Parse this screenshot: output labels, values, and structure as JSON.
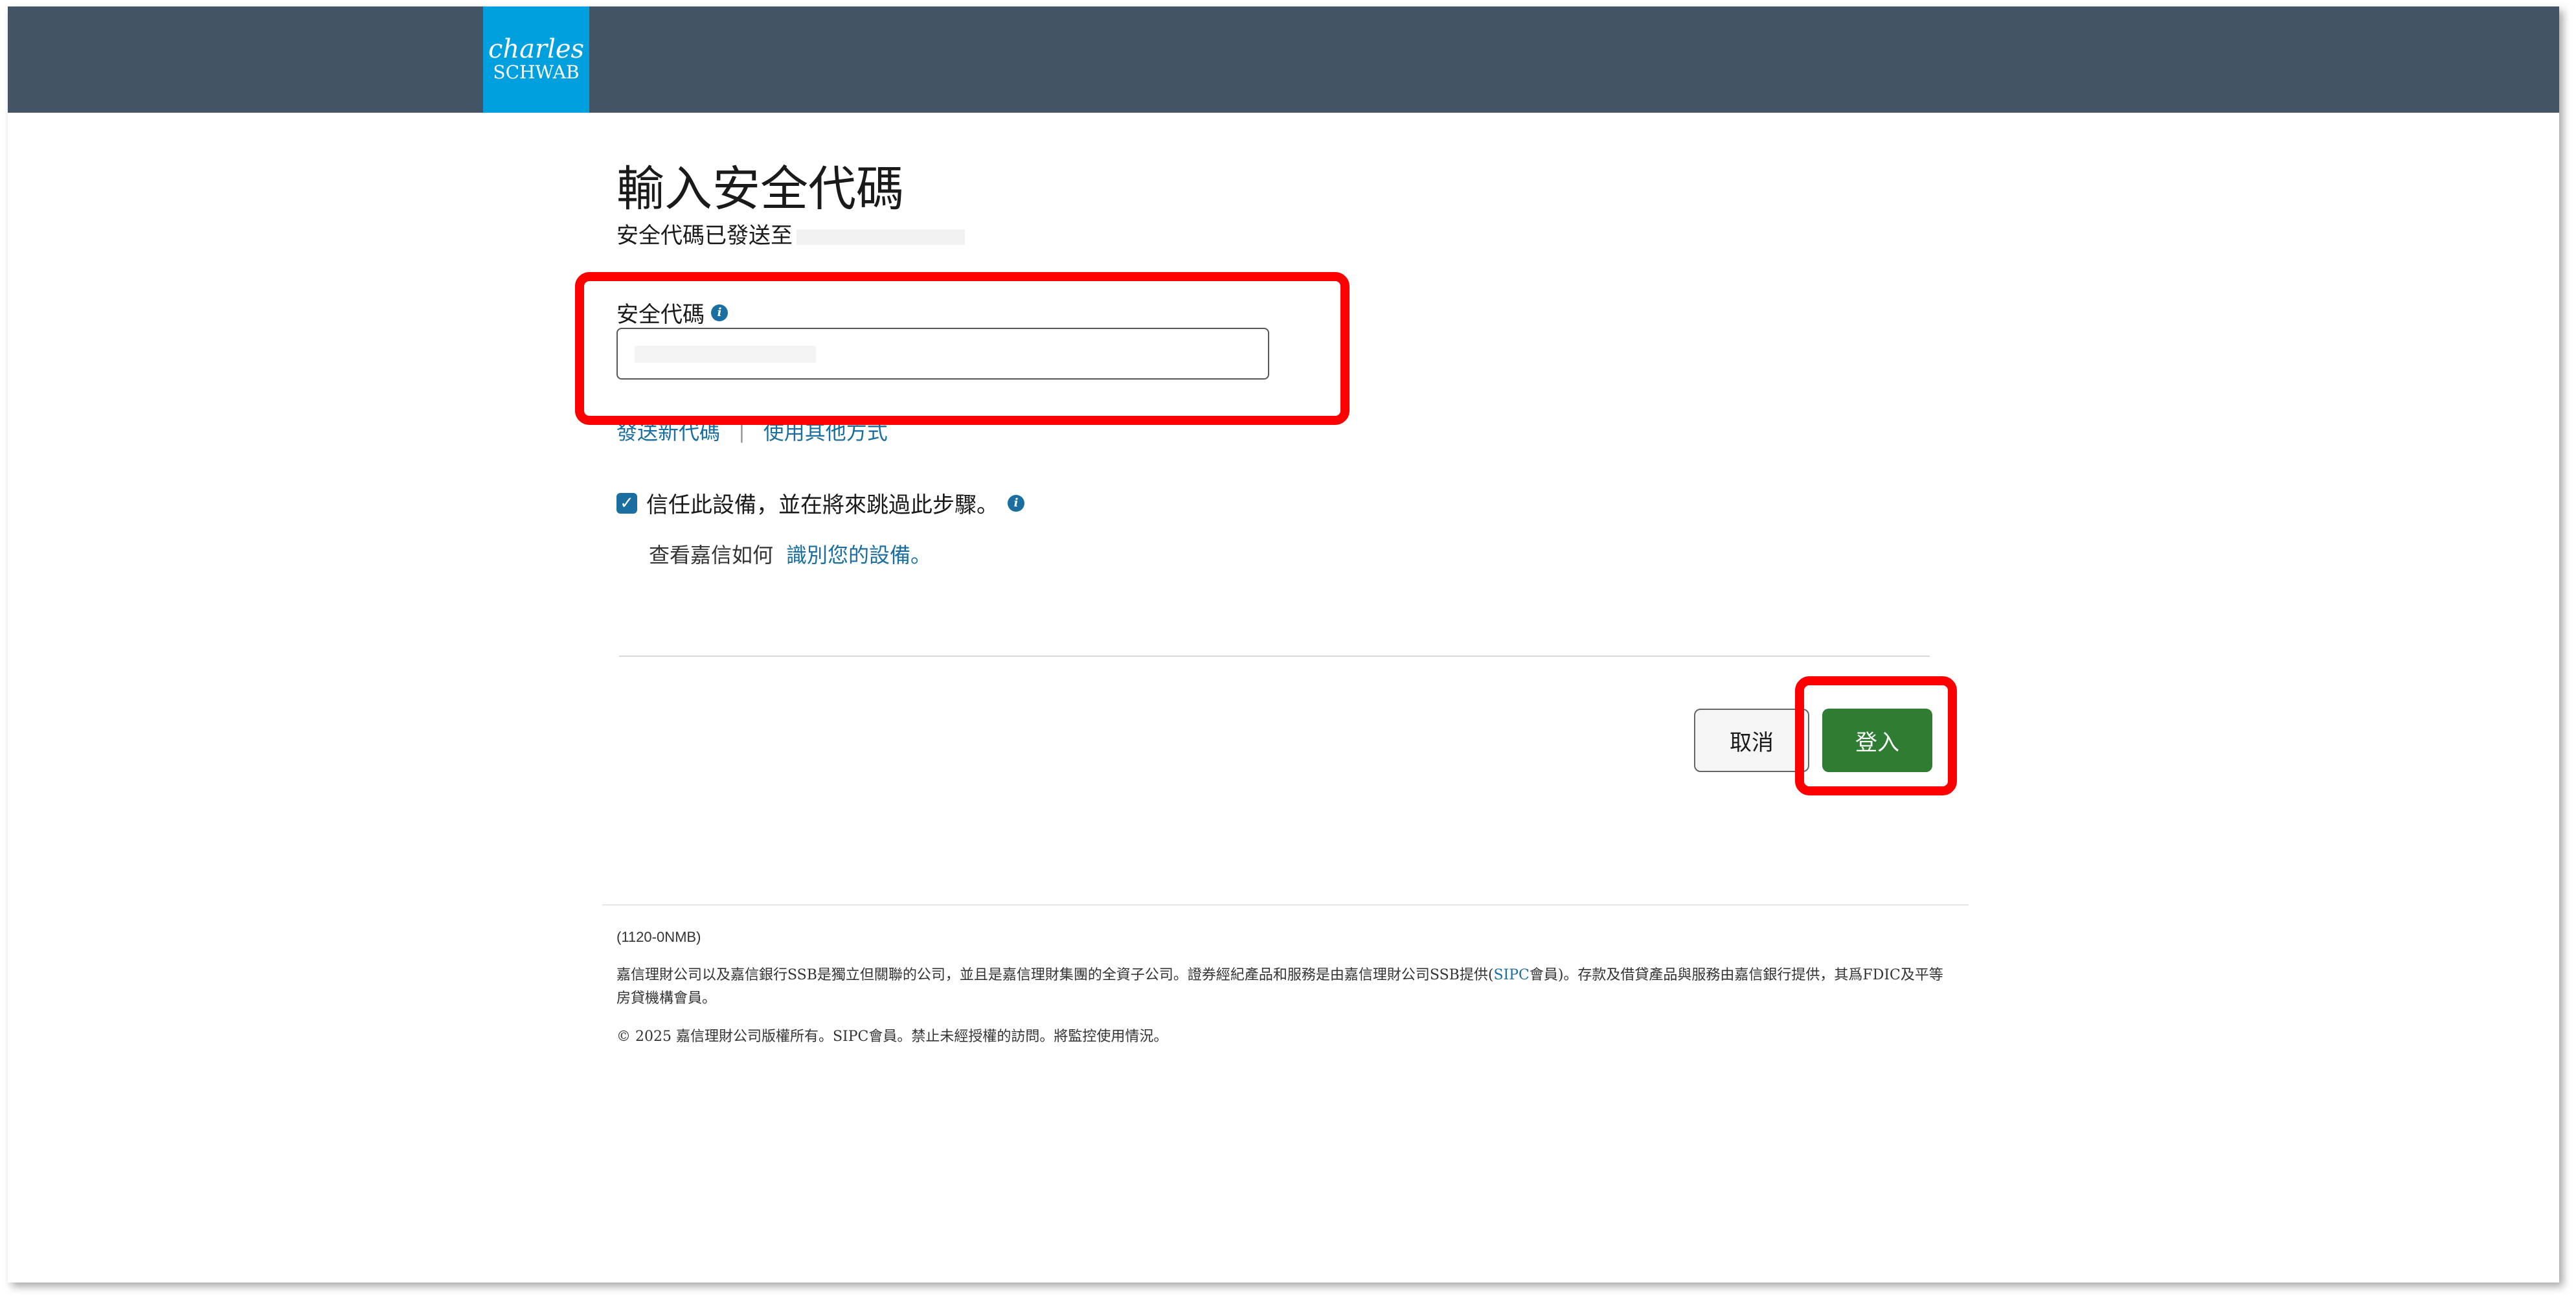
{
  "header": {
    "logo_line1": "charles",
    "logo_line2": "SCHWAB",
    "colors": {
      "bar": "#435564",
      "logo": "#00a0df"
    }
  },
  "page": {
    "title": "輸入安全代碼",
    "subtitle": "安全代碼已發送至"
  },
  "form": {
    "code_label": "安全代碼",
    "info_icon": "info-icon",
    "code_value": "",
    "link_resend": "發送新代碼",
    "link_separator": "|",
    "link_other": "使用其他方式",
    "trust_label": "信任此設備，並在將來跳過此步驟。",
    "trust_checked": true,
    "help_prefix": "查看嘉信如何",
    "help_link": "識別您的設備。"
  },
  "buttons": {
    "cancel": "取消",
    "login": "登入",
    "login_color": "#2e7d32"
  },
  "footer": {
    "code": "(1120-0NMB)",
    "disclaimer_part1": "嘉信理財公司以及嘉信銀行SSB是獨立但關聯的公司，並且是嘉信理財集團的全資子公司。證券經紀產品和服務是由嘉信理財公司SSB提供(",
    "disclaimer_link": "SIPC",
    "disclaimer_part2": "會員)。存款及借貸產品與服務由嘉信銀行提供，其爲FDIC及平等房貸機構會員。",
    "copyright": "© 2025 嘉信理財公司版權所有。SIPC會員。禁止未經授權的訪問。將監控使用情況。"
  }
}
